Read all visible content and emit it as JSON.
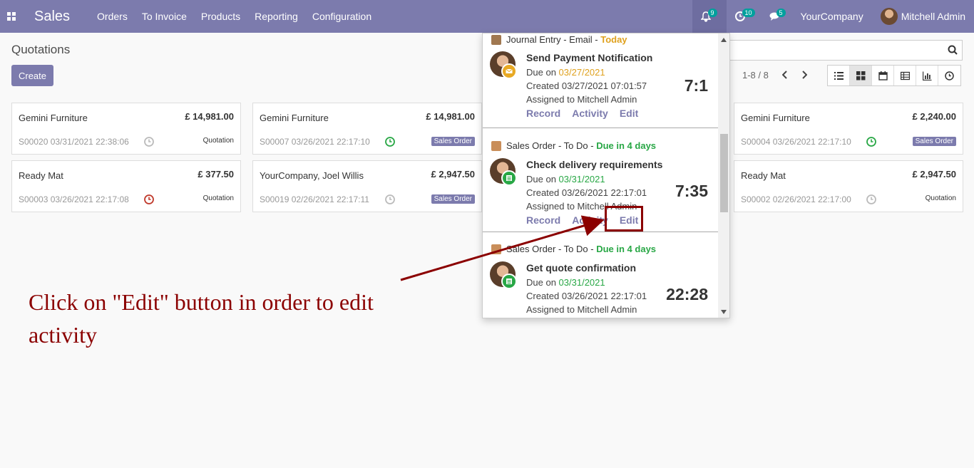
{
  "navbar": {
    "app_name": "Sales",
    "menu": [
      "Orders",
      "To Invoice",
      "Products",
      "Reporting",
      "Configuration"
    ],
    "notifications_count": "9",
    "activities_count": "10",
    "messages_count": "5",
    "company": "YourCompany",
    "user": "Mitchell Admin",
    "color": "#7c7bad"
  },
  "control_panel": {
    "title": "Quotations",
    "create_label": "Create",
    "pager": "1-8 / 8"
  },
  "cards": [
    {
      "partner": "Gemini Furniture",
      "amount": "£ 14,981.00",
      "ref": "S00020 03/31/2021 22:38:06",
      "clock": "grey",
      "status": "Quotation"
    },
    {
      "partner": "Gemini Furniture",
      "amount": "£ 14,981.00",
      "ref": "S00007 03/26/2021 22:17:10",
      "clock": "green",
      "status": "Sales Order"
    },
    {
      "partner": "Gemini Furniture",
      "amount": "£ 2,240.00",
      "ref": "S00004 03/26/2021 22:17:10",
      "clock": "green",
      "status": "Sales Order"
    },
    {
      "partner": "Ready Mat",
      "amount": "£ 377.50",
      "ref": "S00003 03/26/2021 22:17:08",
      "clock": "red",
      "status": "Quotation"
    },
    {
      "partner": "YourCompany, Joel Willis",
      "amount": "£ 2,947.50",
      "ref": "S00019 02/26/2021 22:17:11",
      "clock": "grey",
      "status": "Sales Order"
    },
    {
      "partner": "Ready Mat",
      "amount": "£ 2,947.50",
      "ref": "S00002 02/26/2021 22:17:00",
      "clock": "grey",
      "status": "Quotation"
    }
  ],
  "activities": [
    {
      "head": "Journal Entry - Email - ",
      "due_label": "Today",
      "summary": "Send Payment Notification",
      "due_prefix": "Due on ",
      "due_date": "03/27/2021",
      "created": "Created 03/27/2021 07:01:57",
      "assigned": "Assigned to Mitchell Admin",
      "time": "7:1",
      "type_icon": "envelope-icon"
    },
    {
      "head": "Sales Order - To Do - ",
      "due_label": "Due in 4 days",
      "summary": "Check delivery requirements",
      "due_prefix": "Due on ",
      "due_date": "03/31/2021",
      "created": "Created 03/26/2021 22:17:01",
      "assigned": "Assigned to Mitchell Admin",
      "time": "7:35",
      "type_icon": "list-icon"
    },
    {
      "head": "Sales Order - To Do - ",
      "due_label": "Due in 4 days",
      "summary": "Get quote confirmation",
      "due_prefix": "Due on ",
      "due_date": "03/31/2021",
      "created": "Created 03/26/2021 22:17:01",
      "assigned": "Assigned to Mitchell Admin",
      "time": "22:28",
      "type_icon": "list-icon"
    }
  ],
  "activity_actions": {
    "record": "Record",
    "activity": "Activity",
    "edit": "Edit"
  },
  "annotation": "Click on \"Edit\" button in order to edit activity"
}
